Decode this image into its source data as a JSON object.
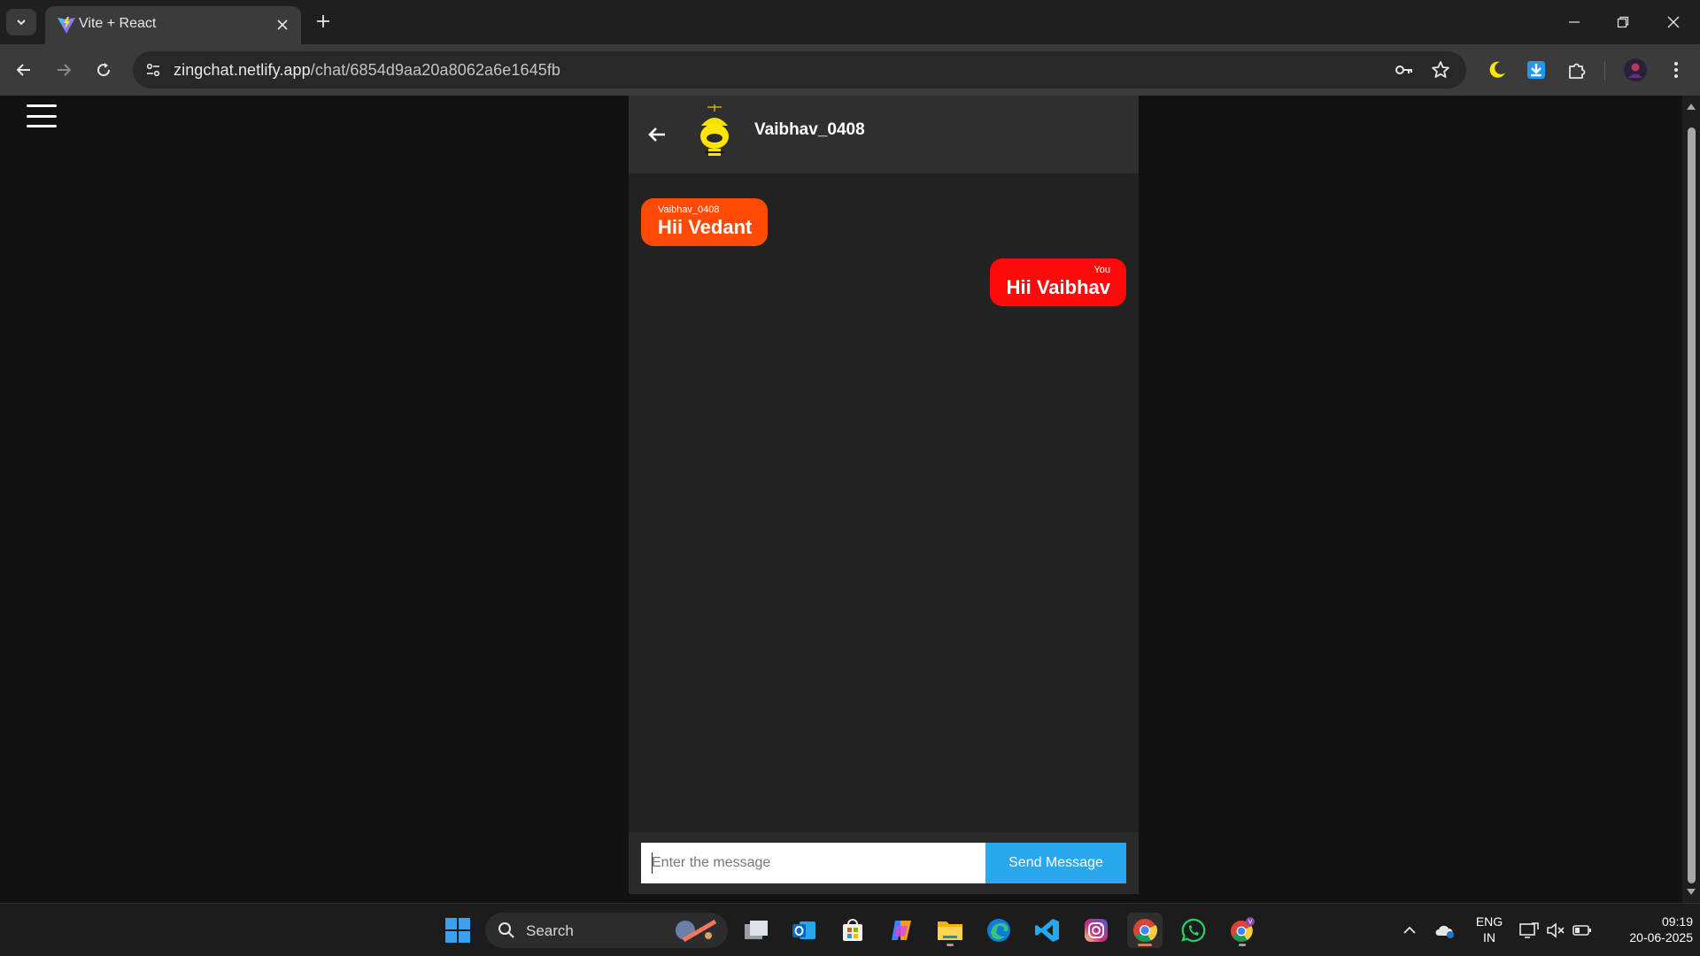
{
  "browser": {
    "tab_title": "Vite + React",
    "url_host": "zingchat.netlify.app",
    "url_path": "/chat/6854d9aa20a8062a6e1645fb"
  },
  "chat": {
    "contact_name": "Vaibhav_0408",
    "messages": [
      {
        "sender": "Vaibhav_0408",
        "text": "Hii Vedant",
        "direction": "incoming",
        "color": "#ff4a05"
      },
      {
        "sender": "You",
        "text": "Hii Vaibhav",
        "direction": "outgoing",
        "color": "#ff0a0a"
      }
    ],
    "composer": {
      "placeholder": "Enter the message",
      "send_label": "Send Message",
      "send_color": "#29a8f0"
    }
  },
  "taskbar": {
    "search_label": "Search",
    "language": "ENG",
    "region": "IN",
    "time": "09:19",
    "date": "20-06-2025"
  }
}
